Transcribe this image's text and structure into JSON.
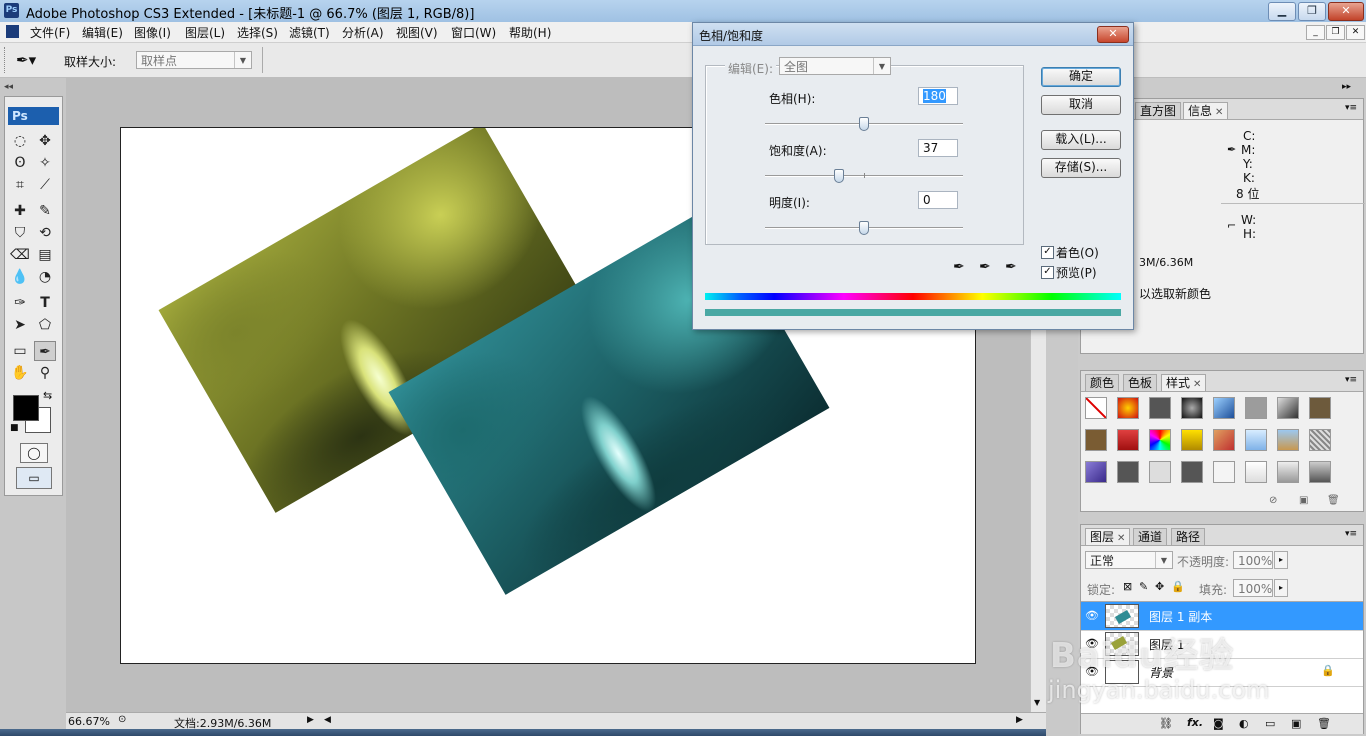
{
  "app": {
    "title": "Adobe Photoshop CS3 Extended - [未标题-1 @ 66.7% (图层 1, RGB/8)]",
    "logo": "Ps"
  },
  "menu": [
    "文件(F)",
    "编辑(E)",
    "图像(I)",
    "图层(L)",
    "选择(S)",
    "滤镜(T)",
    "分析(A)",
    "视图(V)",
    "窗口(W)",
    "帮助(H)"
  ],
  "options_bar": {
    "sample_size_label": "取样大小:",
    "sample_size_value": "取样点"
  },
  "toolbox": {
    "logo": "Ps"
  },
  "status": {
    "zoom": "66.67%",
    "doc": "文档:2.93M/6.36M"
  },
  "dialog": {
    "title": "色相/饱和度",
    "edit_label": "编辑(E):",
    "edit_value": "全图",
    "hue_label": "色相(H):",
    "hue_value": "180",
    "hue_level": 1.0,
    "saturation_label": "饱和度(A):",
    "saturation_value": "37",
    "lightness_label": "明度(I):",
    "lightness_value": "0",
    "ok": "确定",
    "cancel": "取消",
    "load": "载入(L)...",
    "save": "存储(S)...",
    "colorize": "着色(O)",
    "preview": "预览(P)",
    "colorize_checked": true,
    "preview_checked": true,
    "result_color": "#4aa8a4"
  },
  "info_panel": {
    "tabs": [
      "直方图",
      "信息"
    ],
    "cmyk": [
      "C:",
      "M:",
      "Y:",
      "K:"
    ],
    "bits": "8 位",
    "wh": [
      "W:",
      "H:"
    ],
    "doc": "3M/6.36M",
    "hint": "以选取新颜色"
  },
  "styles_panel": {
    "tabs": [
      "颜色",
      "色板",
      "样式"
    ]
  },
  "layers_panel": {
    "tabs": [
      "图层",
      "通道",
      "路径"
    ],
    "blend_mode": "正常",
    "opacity_label": "不透明度:",
    "opacity_value": "100%",
    "lock_label": "锁定:",
    "fill_label": "填充:",
    "fill_value": "100%",
    "layers": [
      {
        "name": "图层 1 副本",
        "selected": true
      },
      {
        "name": "图层 1",
        "selected": false
      },
      {
        "name": "背景",
        "selected": false,
        "locked": true
      }
    ]
  },
  "watermark": {
    "brand": "Baidu经验",
    "url": "jingyan.baidu.com"
  },
  "colors": {
    "accent": "#3399ff",
    "yellow_photo": "#9aa23a",
    "teal_photo": "#2f8c94"
  }
}
